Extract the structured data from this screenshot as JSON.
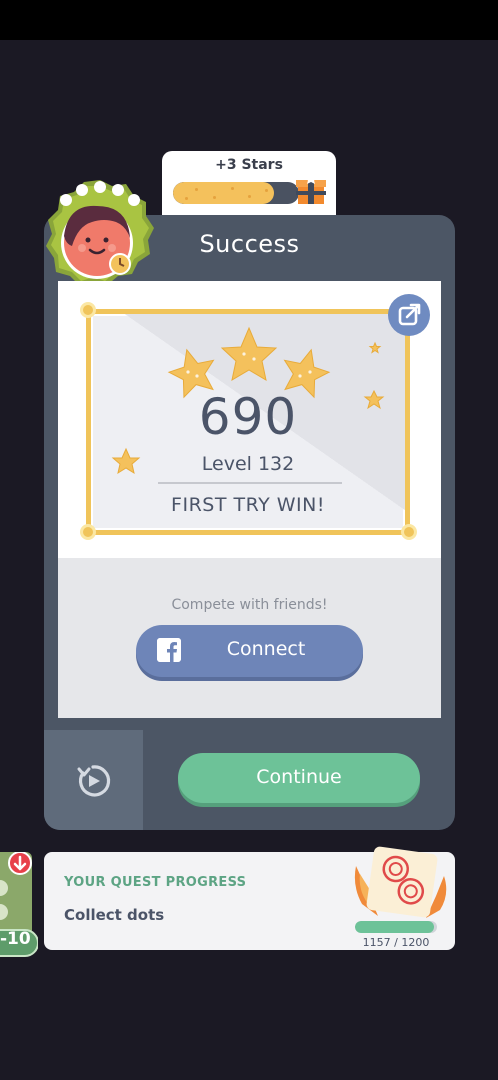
{
  "reward": {
    "label": "+3 Stars",
    "progress": 0.8
  },
  "card": {
    "title": "Success",
    "score": "690",
    "level": "Level 132",
    "subtitle": "FIRST TRY WIN!"
  },
  "social": {
    "prompt": "Compete with friends!",
    "connect_label": "Connect"
  },
  "actions": {
    "continue_label": "Continue"
  },
  "quest": {
    "title": "YOUR QUEST PROGRESS",
    "description": "Collect dots",
    "progress_text": "1157 / 1200",
    "current": 1157,
    "total": 1200
  },
  "side_card": {
    "value": "-10"
  },
  "colors": {
    "background": "#1b1924",
    "card": "#4c5665",
    "gold": "#f0c45a",
    "facebook": "#6e85b8",
    "continue": "#6dc298"
  },
  "icons": [
    "gift-icon",
    "avatar-badge-icon",
    "share-icon",
    "star-icon",
    "facebook-icon",
    "replay-icon",
    "quest-stamp-icon",
    "arrow-down-icon"
  ]
}
